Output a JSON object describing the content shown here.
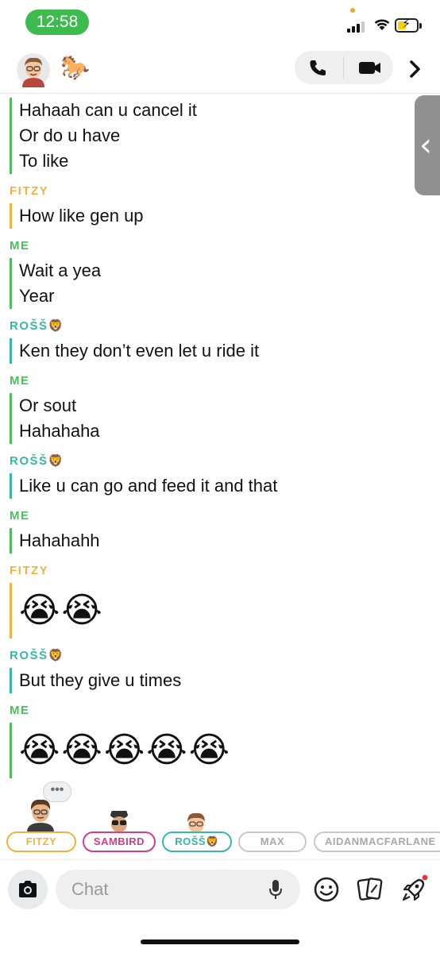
{
  "status_bar": {
    "time": "12:58"
  },
  "header": {
    "friend_emoji": "🐎"
  },
  "messages": [
    {
      "sender": "",
      "style": "me",
      "lines": [
        "Hahaah can u cancel it",
        "Or do u have",
        "To like"
      ]
    },
    {
      "sender": "FITZY",
      "style": "fitzy",
      "lines": [
        "How like gen up"
      ]
    },
    {
      "sender": "ME",
      "style": "me",
      "lines": [
        "Wait a yea",
        "Year"
      ]
    },
    {
      "sender": "ROŠŠ🦁",
      "style": "ross",
      "lines": [
        "Ken they don’t even let u ride it"
      ]
    },
    {
      "sender": "ME",
      "style": "me",
      "lines": [
        "Or sout",
        "Hahahaha"
      ]
    },
    {
      "sender": "ROŠŠ🦁",
      "style": "ross",
      "lines": [
        "Like u can go and feed it and that"
      ]
    },
    {
      "sender": "ME",
      "style": "me",
      "lines": [
        "Hahahahh"
      ]
    },
    {
      "sender": "FITZY",
      "style": "fitzy",
      "emoji": "😭😭"
    },
    {
      "sender": "ROŠŠ🦁",
      "style": "ross",
      "lines": [
        "But they give u times"
      ]
    },
    {
      "sender": "ME",
      "style": "me",
      "emoji": "😭😭😭😭😭"
    }
  ],
  "typing": {
    "bubble": "•••"
  },
  "participants": [
    "FITZY",
    "SAMBIRD",
    "ROŠŠ🦁",
    "MAX",
    "AIDANMACFARLANE"
  ],
  "input": {
    "placeholder": "Chat"
  },
  "colors": {
    "me": "#4bbf5e",
    "fitzy": "#f0b240",
    "ross": "#35b9a4",
    "sambird": "#d93a8a",
    "status_pill": "#3dbb4e"
  }
}
